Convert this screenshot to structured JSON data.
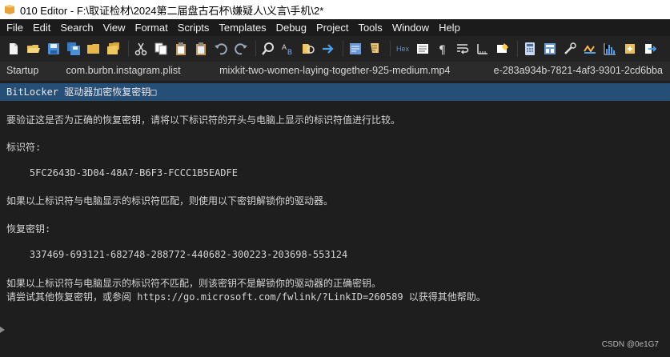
{
  "window": {
    "title": "010 Editor - F:\\取证检材\\2024第二届盘古石杯\\嫌疑人\\义言\\手机\\2*"
  },
  "menu": {
    "items": [
      "File",
      "Edit",
      "Search",
      "View",
      "Format",
      "Scripts",
      "Templates",
      "Debug",
      "Project",
      "Tools",
      "Window",
      "Help"
    ]
  },
  "toolbar": {
    "hex_label": "Hex"
  },
  "tabs": [
    {
      "label": "Startup"
    },
    {
      "label": "com.burbn.instagram.plist"
    },
    {
      "label": "mixkit-two-women-laying-together-925-medium.mp4"
    },
    {
      "label": "e-283a934b-7821-4af3-9301-2cd6bba"
    }
  ],
  "document": {
    "lines": [
      "BitLocker 驱动器加密恢复密钥□",
      "要验证这是否为正确的恢复密钥，请将以下标识符的开头与电脑上显示的标识符值进行比较。",
      "标识符:",
      "    5FC2643D-3D04-48A7-B6F3-FCCC1B5EADFE",
      "如果以上标识符与电脑显示的标识符匹配，则使用以下密钥解锁你的驱动器。",
      "恢复密钥:",
      "    337469-693121-682748-288772-440682-300223-203698-553124",
      "如果以上标识符与电脑显示的标识符不匹配，则该密钥不是解锁你的驱动器的正确密钥。",
      "请尝试其他恢复密钥，或参阅 https://go.microsoft.com/fwlink/?LinkID=260589 以获得其他帮助。"
    ]
  },
  "watermark": "CSDN @0e1G7",
  "colors": {
    "background": "#1e1e1e",
    "selection": "#264f78",
    "menubar": "#1b1b1b"
  }
}
